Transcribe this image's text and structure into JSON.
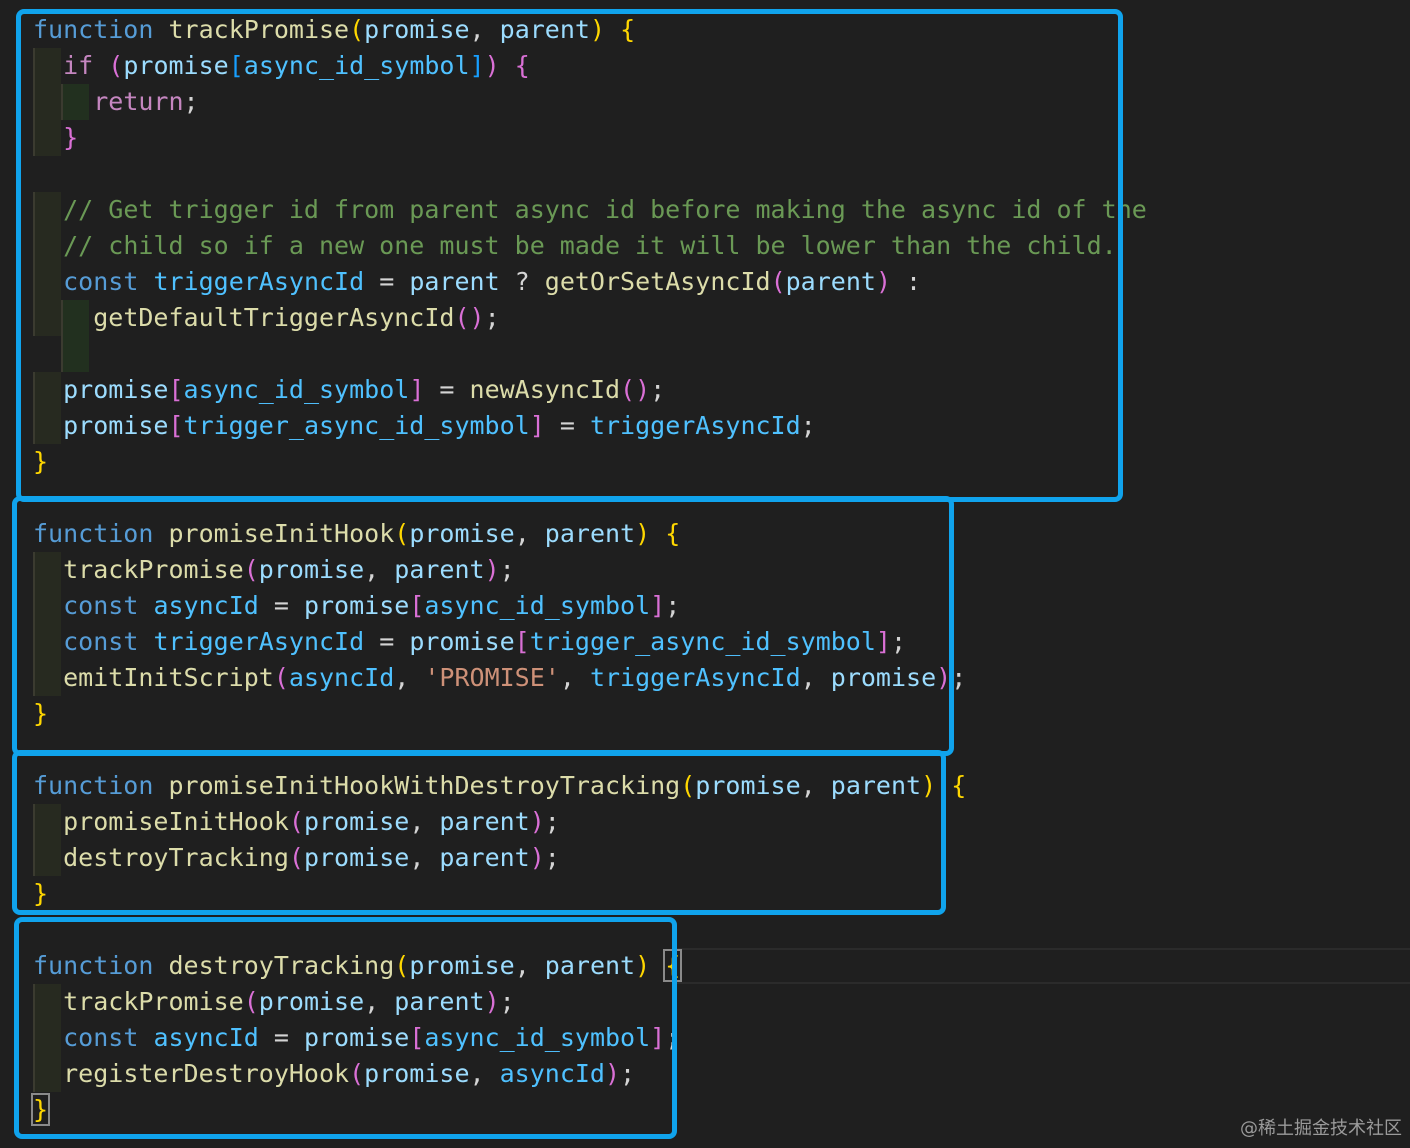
{
  "watermark": "@稀土掘金技术社区",
  "code": {
    "block1": {
      "l1": {
        "kw": "function",
        "name": "trackPromise",
        "p1": "promise",
        "p2": "parent"
      },
      "l2": {
        "kw": "if",
        "obj": "promise",
        "key": "async_id_symbol"
      },
      "l3": {
        "kw": "return"
      },
      "c1": "// Get trigger id from parent async id before making the async id of the",
      "c2": "// child so if a new one must be made it will be lower than the child.",
      "l4": {
        "kw": "const",
        "var": "triggerAsyncId",
        "p": "parent",
        "fn": "getOrSetAsyncId",
        "arg": "parent"
      },
      "l5": {
        "fn": "getDefaultTriggerAsyncId"
      },
      "l6": {
        "obj": "promise",
        "key": "async_id_symbol",
        "fn": "newAsyncId"
      },
      "l7": {
        "obj": "promise",
        "key": "trigger_async_id_symbol",
        "val": "triggerAsyncId"
      }
    },
    "block2": {
      "l1": {
        "kw": "function",
        "name": "promiseInitHook",
        "p1": "promise",
        "p2": "parent"
      },
      "l2": {
        "fn": "trackPromise",
        "a1": "promise",
        "a2": "parent"
      },
      "l3": {
        "kw": "const",
        "var": "asyncId",
        "obj": "promise",
        "key": "async_id_symbol"
      },
      "l4": {
        "kw": "const",
        "var": "triggerAsyncId",
        "obj": "promise",
        "key": "trigger_async_id_symbol"
      },
      "l5": {
        "fn": "emitInitScript",
        "a1": "asyncId",
        "str": "'PROMISE'",
        "a3": "triggerAsyncId",
        "a4": "promise"
      }
    },
    "block3": {
      "l1": {
        "kw": "function",
        "name": "promiseInitHookWithDestroyTracking",
        "p1": "promise",
        "p2": "parent"
      },
      "l2": {
        "fn": "promiseInitHook",
        "a1": "promise",
        "a2": "parent"
      },
      "l3": {
        "fn": "destroyTracking",
        "a1": "promise",
        "a2": "parent"
      }
    },
    "block4": {
      "l1": {
        "kw": "function",
        "name": "destroyTracking",
        "p1": "promise",
        "p2": "parent"
      },
      "l2": {
        "fn": "trackPromise",
        "a1": "promise",
        "a2": "parent"
      },
      "l3": {
        "kw": "const",
        "var": "asyncId",
        "obj": "promise",
        "key": "async_id_symbol"
      },
      "l4": {
        "fn": "registerDestroyHook",
        "a1": "promise",
        "a2": "asyncId"
      }
    }
  }
}
